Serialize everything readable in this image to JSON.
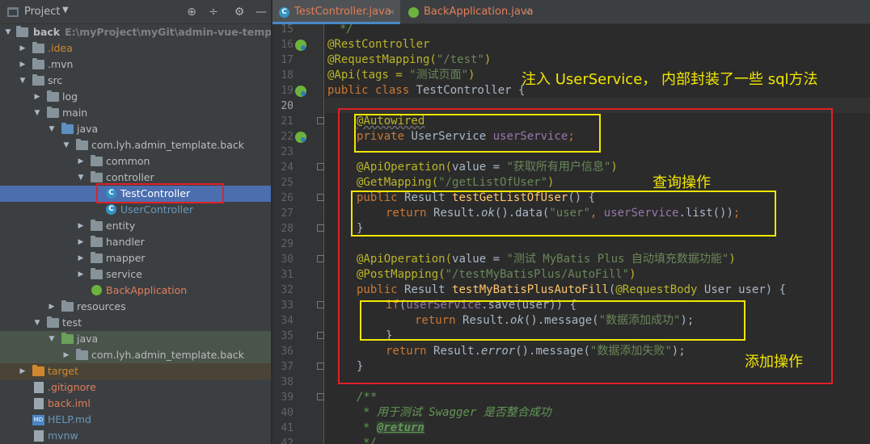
{
  "project_panel": {
    "title": "Project",
    "toolbar_icons": [
      "target-icon",
      "collapse-icon",
      "gear-icon",
      "hide-icon"
    ],
    "tree": [
      {
        "label": "back",
        "sub": "E:\\myProject\\myGit\\admin-vue-template\\bac"
      },
      {
        "label": ".idea"
      },
      {
        "label": ".mvn"
      },
      {
        "label": "src"
      },
      {
        "label": "log"
      },
      {
        "label": "main"
      },
      {
        "label": "java"
      },
      {
        "label": "com.lyh.admin_template.back"
      },
      {
        "label": "common"
      },
      {
        "label": "controller"
      },
      {
        "label": "TestController"
      },
      {
        "label": "UserController"
      },
      {
        "label": "entity"
      },
      {
        "label": "handler"
      },
      {
        "label": "mapper"
      },
      {
        "label": "service"
      },
      {
        "label": "BackApplication"
      },
      {
        "label": "resources"
      },
      {
        "label": "test"
      },
      {
        "label": "java"
      },
      {
        "label": "com.lyh.admin_template.back"
      },
      {
        "label": "target"
      },
      {
        "label": ".gitignore"
      },
      {
        "label": "back.iml"
      },
      {
        "label": "HELP.md"
      },
      {
        "label": "mvnw"
      }
    ]
  },
  "editor": {
    "tabs": [
      {
        "label": "TestController.java",
        "close": "×",
        "active": true
      },
      {
        "label": "BackApplication.java",
        "close": "×",
        "active": false
      }
    ],
    "line_numbers": [
      "15",
      "16",
      "17",
      "18",
      "19",
      "20",
      "21",
      "22",
      "23",
      "24",
      "25",
      "26",
      "27",
      "28",
      "29",
      "30",
      "31",
      "32",
      "33",
      "34",
      "35",
      "36",
      "37",
      "38",
      "39",
      "40",
      "41",
      "42"
    ],
    "code": {
      "l15": "*/",
      "l16": "@RestController",
      "l17a": "@RequestMapping(",
      "l17b": "\"/test\"",
      "l17c": ")",
      "l18a": "@Api(tags = ",
      "l18b": "\"测试页面\"",
      "l18c": ")",
      "l19a": "public class ",
      "l19b": "TestController {",
      "l21": "@Autowired",
      "l22a": "private ",
      "l22b": "UserService ",
      "l22c": "userService",
      "l22d": ";",
      "l24a": "@ApiOperation(",
      "l24b": "value = ",
      "l24c": "\"获取所有用户信息\"",
      "l24d": ")",
      "l25a": "@GetMapping(",
      "l25b": "\"/getListOfUser\"",
      "l25c": ")",
      "l26a": "public ",
      "l26b": "Result ",
      "l26c": "testGetListOfUser",
      "l26d": "() {",
      "l27a": "return ",
      "l27b": "Result.",
      "l27c": "ok",
      "l27d": "().data(",
      "l27e": "\"user\"",
      "l27f": ", ",
      "l27g": "userService",
      "l27h": ".list())",
      "l27i": ";",
      "l28": "}",
      "l30a": "@ApiOperation(",
      "l30b": "value = ",
      "l30c": "\"测试 MyBatis Plus 自动填充数据功能\"",
      "l30d": ")",
      "l31a": "@PostMapping(",
      "l31b": "\"/testMyBatisPlus/AutoFill\"",
      "l31c": ")",
      "l32a": "public ",
      "l32b": "Result ",
      "l32c": "testMyBatisPlusAutoFill",
      "l32d": "(",
      "l32e": "@RequestBody ",
      "l32f": "User user) {",
      "l33a": "if",
      "l33b": "(",
      "l33c": "userService",
      "l33d": ".save(user)) {",
      "l34a": "return ",
      "l34b": "Result.",
      "l34c": "ok",
      "l34d": "().message(",
      "l34e": "\"数据添加成功\"",
      "l34f": ");",
      "l35": "}",
      "l36a": "return ",
      "l36b": "Result.",
      "l36c": "error",
      "l36d": "().message(",
      "l36e": "\"数据添加失败\"",
      "l36f": ");",
      "l37": "}",
      "l39": "/**",
      "l40": "* 用于测试 Swagger 是否整合成功",
      "l41a": "* ",
      "l41b": "@return",
      "l42": "*/"
    }
  },
  "annotations": {
    "inject_note": "注入 UserService， 内部封装了一些 sql方法",
    "query_note": "查询操作",
    "add_note": "添加操作"
  },
  "colors": {
    "annotation_box": "#e0202a",
    "highlight_box": "#f2e600",
    "note_text": "#f2e600",
    "selection": "#4b6eaf"
  }
}
